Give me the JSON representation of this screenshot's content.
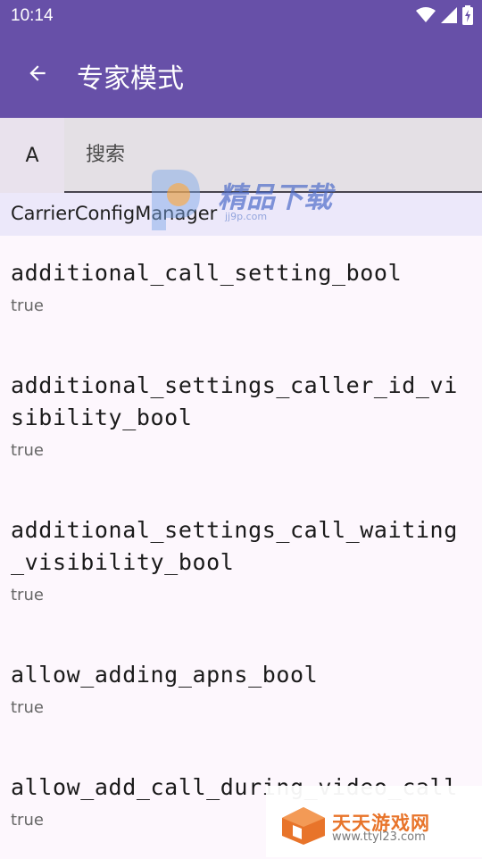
{
  "status_bar": {
    "time": "10:14",
    "icons": [
      "wifi-icon",
      "signal-icon",
      "battery-charging-icon"
    ]
  },
  "app_bar": {
    "title": "专家模式",
    "back_icon": "arrow-back-icon"
  },
  "search": {
    "letter_button": "A",
    "placeholder": "搜索"
  },
  "section": {
    "title": "CarrierConfigManager"
  },
  "items": [
    {
      "key": "additional_call_setting_bool",
      "value": "true"
    },
    {
      "key": "additional_settings_caller_id_visibility_bool",
      "value": "true"
    },
    {
      "key": "additional_settings_call_waiting_visibility_bool",
      "value": "true"
    },
    {
      "key": "allow_adding_apns_bool",
      "value": "true"
    },
    {
      "key": "allow_add_call_during_video_call",
      "value": "true"
    }
  ],
  "watermarks": {
    "top": {
      "title": "精品下载",
      "url": "jj9p.com"
    },
    "bottom": {
      "title": "天天游戏网",
      "url": "www.ttyl23.com"
    }
  },
  "colors": {
    "primary": "#6750a8",
    "background": "#fdf7fd",
    "section_bg": "#ece8fa"
  }
}
